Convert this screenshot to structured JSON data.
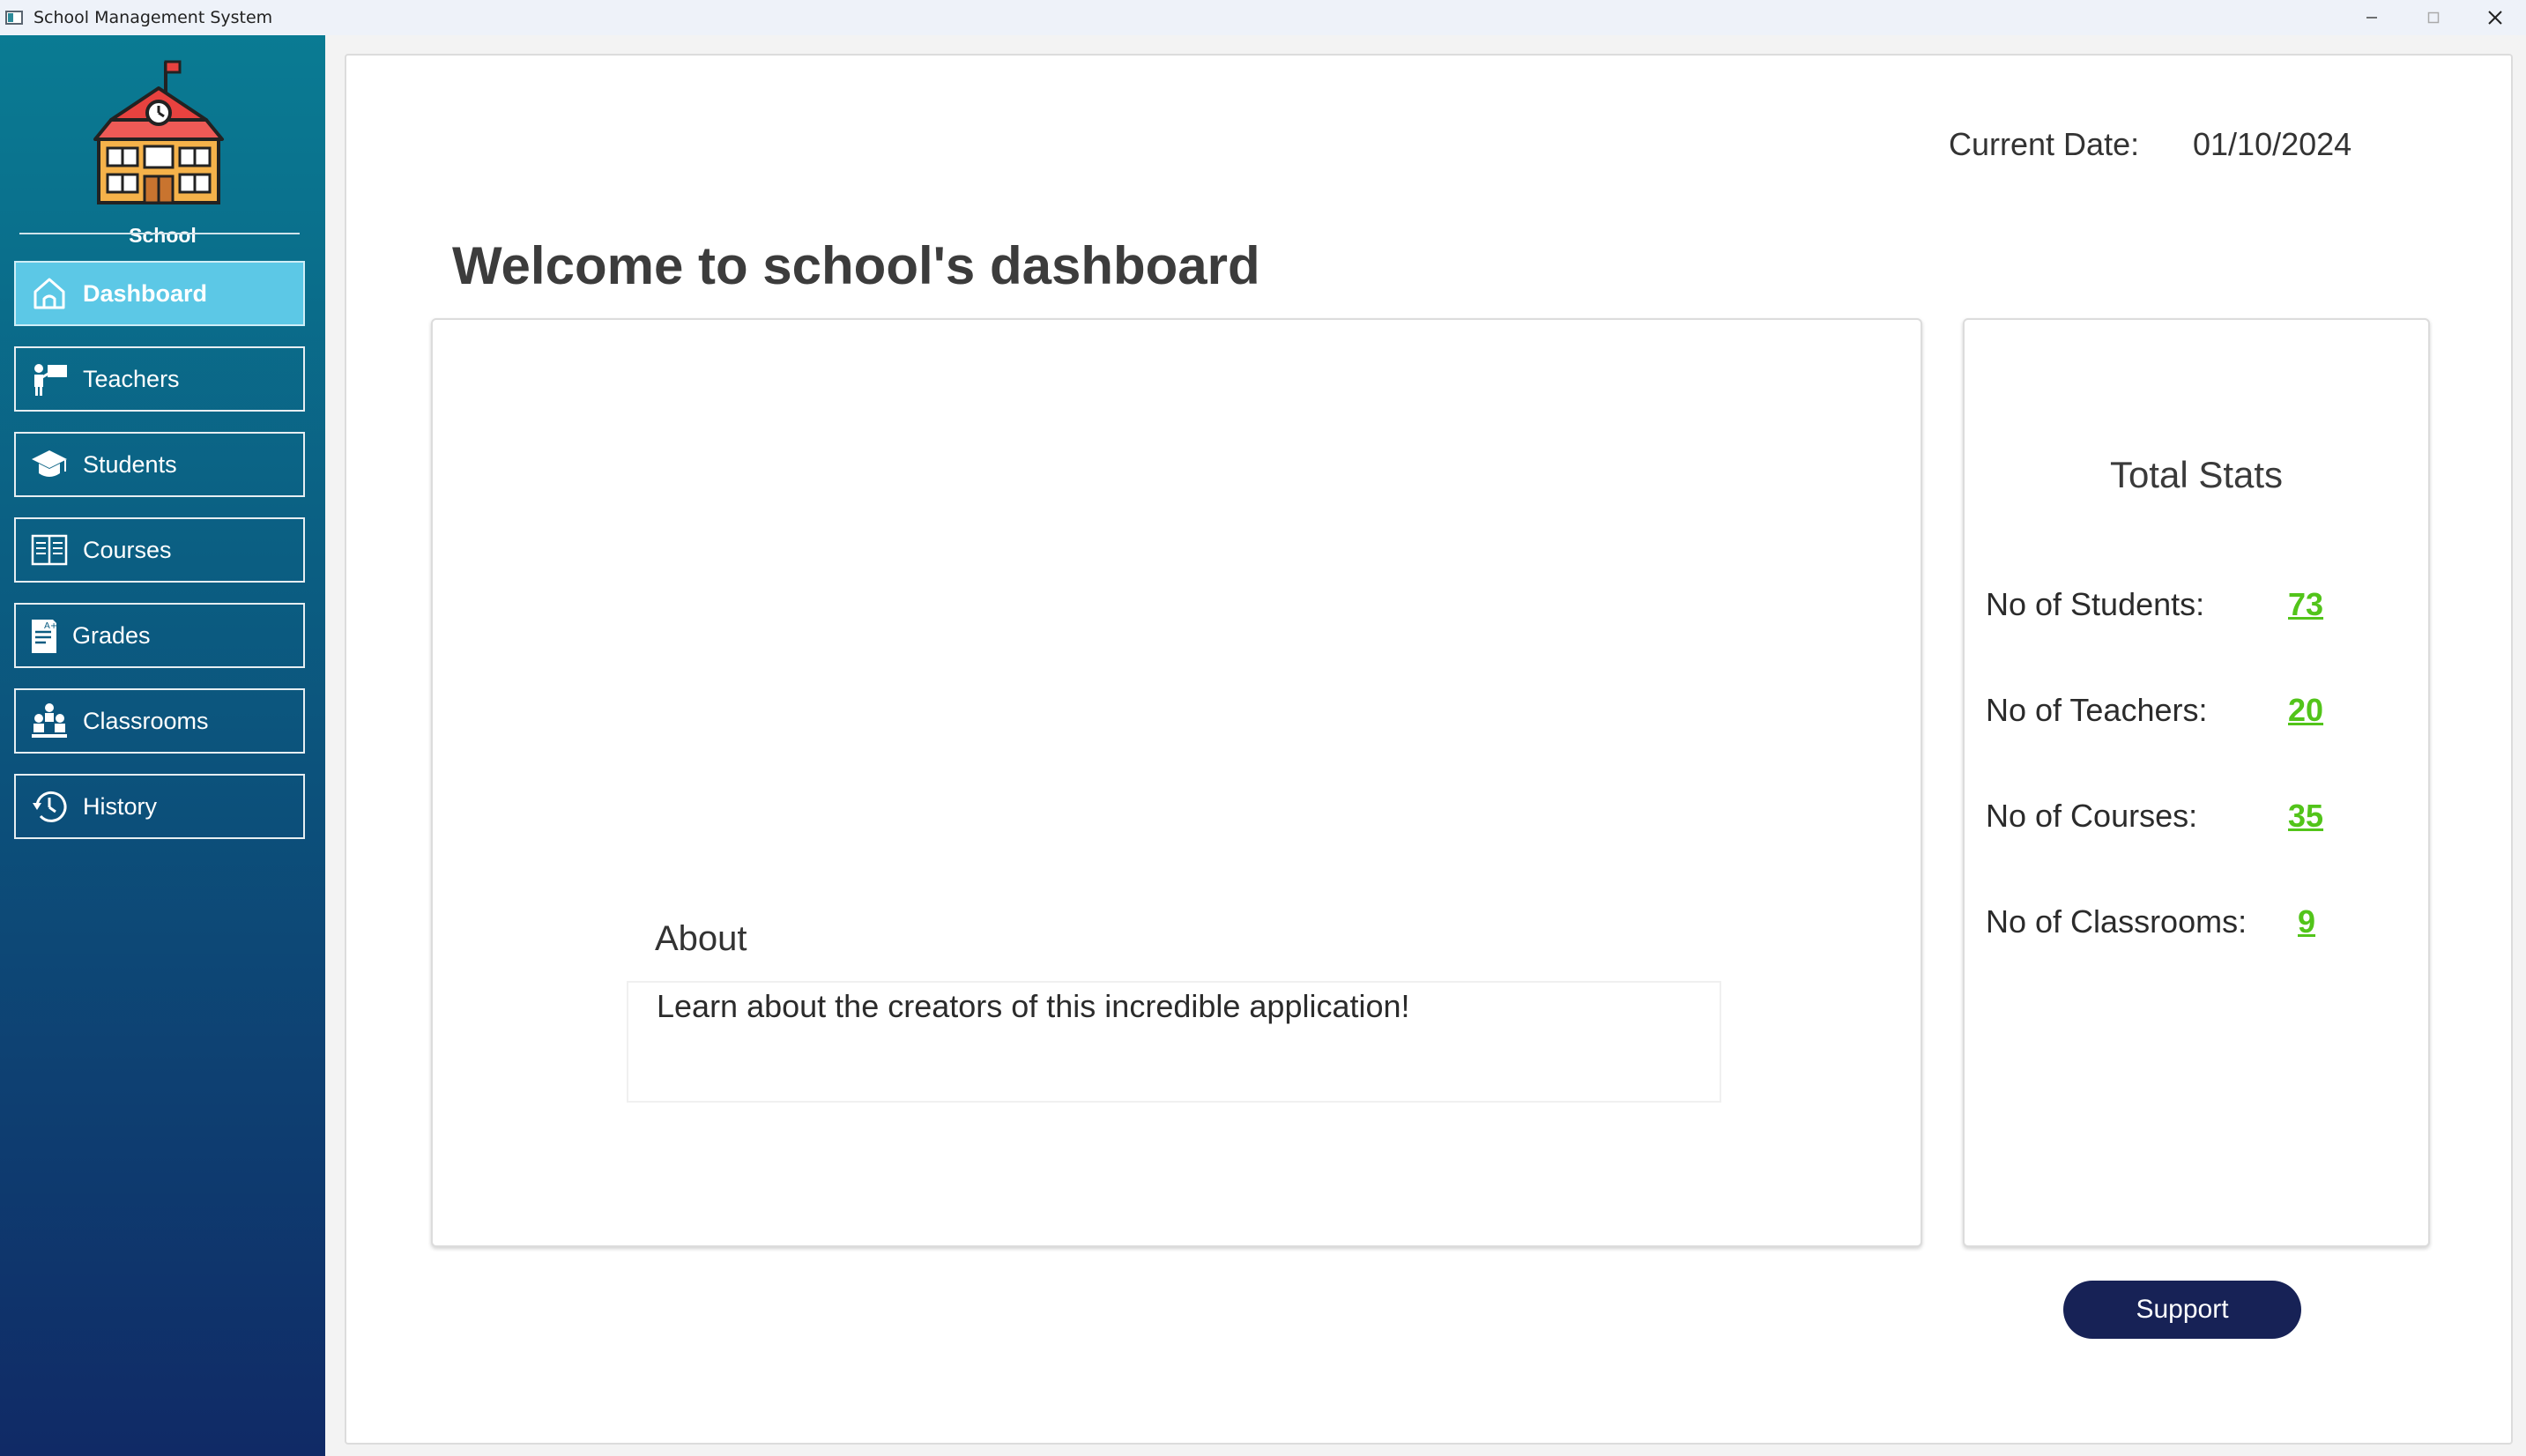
{
  "window": {
    "title": "School Management System"
  },
  "sidebar": {
    "logo_label": "School",
    "items": [
      {
        "label": "Dashboard",
        "icon": "home-icon",
        "active": true
      },
      {
        "label": "Teachers",
        "icon": "teacher-icon"
      },
      {
        "label": "Students",
        "icon": "graduation-cap-icon"
      },
      {
        "label": "Courses",
        "icon": "book-icon"
      },
      {
        "label": "Grades",
        "icon": "grades-document-icon"
      },
      {
        "label": "Classrooms",
        "icon": "classroom-icon"
      },
      {
        "label": "History",
        "icon": "history-icon"
      }
    ]
  },
  "header": {
    "date_label": "Current Date:",
    "date_value": "01/10/2024",
    "welcome": "Welcome to school's dashboard"
  },
  "about": {
    "title": "About",
    "text": "Learn about the creators of this incredible application!"
  },
  "stats": {
    "title": "Total Stats",
    "rows": [
      {
        "label": "No of Students:",
        "value": "73"
      },
      {
        "label": "No of Teachers:",
        "value": "20"
      },
      {
        "label": "No of Courses:",
        "value": "35"
      },
      {
        "label": "No of Classrooms:",
        "value": "9"
      }
    ]
  },
  "support": {
    "label": "Support"
  },
  "colors": {
    "sidebar_top": "#0a7b93",
    "sidebar_bottom": "#102a66",
    "active_nav": "#5cc8e6",
    "stat_value": "#52c41a",
    "support_button": "#172256"
  }
}
